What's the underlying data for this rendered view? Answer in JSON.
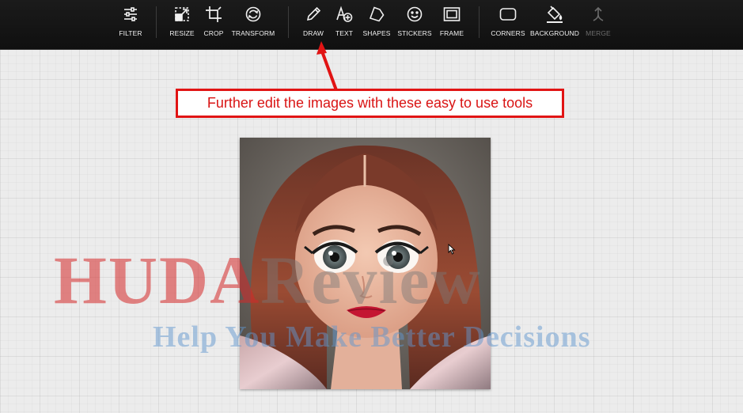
{
  "toolbar": {
    "tools": [
      {
        "label": "FILTER",
        "icon": "sliders-icon"
      },
      {
        "label": "RESIZE",
        "icon": "resize-icon"
      },
      {
        "label": "CROP",
        "icon": "crop-icon"
      },
      {
        "label": "TRANSFORM",
        "icon": "transform-icon"
      },
      {
        "label": "DRAW",
        "icon": "pencil-icon"
      },
      {
        "label": "TEXT",
        "icon": "text-icon"
      },
      {
        "label": "SHAPES",
        "icon": "pentagon-icon"
      },
      {
        "label": "STICKERS",
        "icon": "smiley-icon"
      },
      {
        "label": "FRAME",
        "icon": "frame-icon"
      },
      {
        "label": "CORNERS",
        "icon": "rounded-rect-icon"
      },
      {
        "label": "BACKGROUND",
        "icon": "paint-bucket-icon"
      },
      {
        "label": "MERGE",
        "icon": "merge-icon",
        "disabled": true
      }
    ]
  },
  "callout": {
    "text": "Further edit the images with these easy to use tools",
    "color": "#e11414"
  },
  "watermark": {
    "title_part1": "HUDA",
    "title_part2": "Review",
    "subtitle": "Help You Make Better Decisions"
  }
}
